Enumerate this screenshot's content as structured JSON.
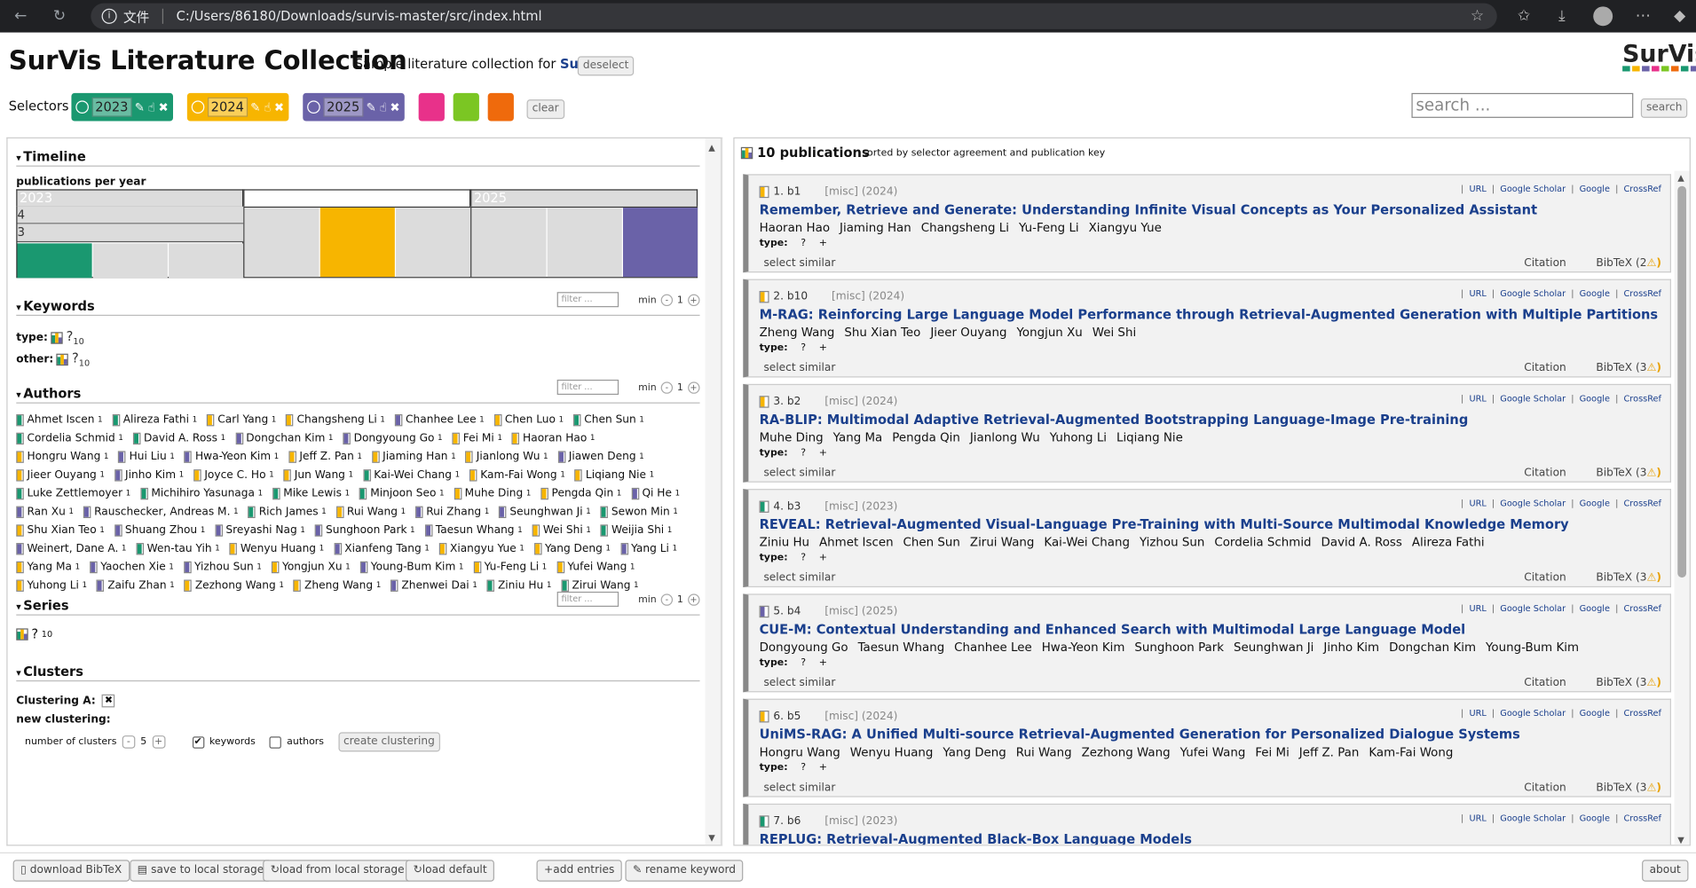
{
  "browser": {
    "protocol_label": "文件",
    "url": "C:/Users/86180/Downloads/survis-master/src/index.html"
  },
  "header": {
    "title": "SurVis Literature Collection",
    "subtitle_prefix": "Sample literature collection for ",
    "subtitle_link": "SurVis",
    "deselect": "deselect",
    "logo_text": "SurVis",
    "logo_colors": [
      "#1a9870",
      "#f7b500",
      "#6a62a8",
      "#e8318a",
      "#7bc623",
      "#ef6a0c",
      "#1a9870",
      "#6a62a8"
    ]
  },
  "selectors": {
    "label": "Selectors",
    "items": [
      {
        "year": "2023",
        "color": "#1a9870"
      },
      {
        "year": "2024",
        "color": "#f7b500"
      },
      {
        "year": "2025",
        "color": "#6a62a8"
      }
    ],
    "swatches": [
      "#e8318a",
      "#7bc623",
      "#ef6a0c"
    ],
    "clear": "clear"
  },
  "search": {
    "placeholder": "search ...",
    "button": "search"
  },
  "timeline": {
    "heading": "Timeline",
    "subheading": "publications per year",
    "years": [
      "2023",
      "2024",
      "2025"
    ],
    "axis_labels": [
      "4",
      "3"
    ]
  },
  "chart_data": {
    "type": "bar",
    "title": "publications per year",
    "categories": [
      "2023",
      "2024",
      "2025"
    ],
    "series": [
      {
        "values": [
          4,
          4,
          2
        ]
      }
    ]
  },
  "keywords": {
    "heading": "Keywords",
    "filter_placeholder": "filter ...",
    "min_label": "min",
    "min_value": "1",
    "rows": [
      {
        "label": "type:",
        "value": "?",
        "count": "10"
      },
      {
        "label": "other:",
        "value": "?",
        "count": "10"
      }
    ]
  },
  "authors": {
    "heading": "Authors",
    "filter_placeholder": "filter ...",
    "min_label": "min",
    "min_value": "1",
    "list": [
      {
        "name": "Ahmet Iscen",
        "n": "1",
        "c": "#1a9870"
      },
      {
        "name": "Alireza Fathi",
        "n": "1",
        "c": "#1a9870"
      },
      {
        "name": "Carl Yang",
        "n": "1",
        "c": "#f7b500"
      },
      {
        "name": "Changsheng Li",
        "n": "1",
        "c": "#f7b500"
      },
      {
        "name": "Chanhee Lee",
        "n": "1",
        "c": "#6a62a8"
      },
      {
        "name": "Chen Luo",
        "n": "1",
        "c": "#f7b500"
      },
      {
        "name": "Chen Sun",
        "n": "1",
        "c": "#1a9870"
      },
      {
        "name": "Cordelia Schmid",
        "n": "1",
        "c": "#1a9870"
      },
      {
        "name": "David A. Ross",
        "n": "1",
        "c": "#1a9870"
      },
      {
        "name": "Dongchan Kim",
        "n": "1",
        "c": "#6a62a8"
      },
      {
        "name": "Dongyoung Go",
        "n": "1",
        "c": "#6a62a8"
      },
      {
        "name": "Fei Mi",
        "n": "1",
        "c": "#f7b500"
      },
      {
        "name": "Haoran Hao",
        "n": "1",
        "c": "#f7b500"
      },
      {
        "name": "Hongru Wang",
        "n": "1",
        "c": "#f7b500"
      },
      {
        "name": "Hui Liu",
        "n": "1",
        "c": "#6a62a8"
      },
      {
        "name": "Hwa-Yeon Kim",
        "n": "1",
        "c": "#6a62a8"
      },
      {
        "name": "Jeff Z. Pan",
        "n": "1",
        "c": "#f7b500"
      },
      {
        "name": "Jiaming Han",
        "n": "1",
        "c": "#f7b500"
      },
      {
        "name": "Jianlong Wu",
        "n": "1",
        "c": "#f7b500"
      },
      {
        "name": "Jiawen Deng",
        "n": "1",
        "c": "#6a62a8"
      },
      {
        "name": "Jieer Ouyang",
        "n": "1",
        "c": "#f7b500"
      },
      {
        "name": "Jinho Kim",
        "n": "1",
        "c": "#6a62a8"
      },
      {
        "name": "Joyce C. Ho",
        "n": "1",
        "c": "#f7b500"
      },
      {
        "name": "Jun Wang",
        "n": "1",
        "c": "#f7b500"
      },
      {
        "name": "Kai-Wei Chang",
        "n": "1",
        "c": "#1a9870"
      },
      {
        "name": "Kam-Fai Wong",
        "n": "1",
        "c": "#f7b500"
      },
      {
        "name": "Liqiang Nie",
        "n": "1",
        "c": "#f7b500"
      },
      {
        "name": "Luke Zettlemoyer",
        "n": "1",
        "c": "#1a9870"
      },
      {
        "name": "Michihiro Yasunaga",
        "n": "1",
        "c": "#1a9870"
      },
      {
        "name": "Mike Lewis",
        "n": "1",
        "c": "#1a9870"
      },
      {
        "name": "Minjoon Seo",
        "n": "1",
        "c": "#1a9870"
      },
      {
        "name": "Muhe Ding",
        "n": "1",
        "c": "#f7b500"
      },
      {
        "name": "Pengda Qin",
        "n": "1",
        "c": "#f7b500"
      },
      {
        "name": "Qi He",
        "n": "1",
        "c": "#6a62a8"
      },
      {
        "name": "Ran Xu",
        "n": "1",
        "c": "#6a62a8"
      },
      {
        "name": "Rauschecker, Andreas M.",
        "n": "1",
        "c": "#6a62a8"
      },
      {
        "name": "Rich James",
        "n": "1",
        "c": "#1a9870"
      },
      {
        "name": "Rui Wang",
        "n": "1",
        "c": "#f7b500"
      },
      {
        "name": "Rui Zhang",
        "n": "1",
        "c": "#6a62a8"
      },
      {
        "name": "Seunghwan Ji",
        "n": "1",
        "c": "#6a62a8"
      },
      {
        "name": "Sewon Min",
        "n": "1",
        "c": "#1a9870"
      },
      {
        "name": "Shu Xian Teo",
        "n": "1",
        "c": "#f7b500"
      },
      {
        "name": "Shuang Zhou",
        "n": "1",
        "c": "#6a62a8"
      },
      {
        "name": "Sreyashi Nag",
        "n": "1",
        "c": "#6a62a8"
      },
      {
        "name": "Sunghoon Park",
        "n": "1",
        "c": "#6a62a8"
      },
      {
        "name": "Taesun Whang",
        "n": "1",
        "c": "#6a62a8"
      },
      {
        "name": "Wei Shi",
        "n": "1",
        "c": "#f7b500"
      },
      {
        "name": "Weijia Shi",
        "n": "1",
        "c": "#1a9870"
      },
      {
        "name": "Weinert, Dane A.",
        "n": "1",
        "c": "#6a62a8"
      },
      {
        "name": "Wen-tau Yih",
        "n": "1",
        "c": "#1a9870"
      },
      {
        "name": "Wenyu Huang",
        "n": "1",
        "c": "#f7b500"
      },
      {
        "name": "Xianfeng Tang",
        "n": "1",
        "c": "#6a62a8"
      },
      {
        "name": "Xiangyu Yue",
        "n": "1",
        "c": "#f7b500"
      },
      {
        "name": "Yang Deng",
        "n": "1",
        "c": "#f7b500"
      },
      {
        "name": "Yang Li",
        "n": "1",
        "c": "#6a62a8"
      },
      {
        "name": "Yang Ma",
        "n": "1",
        "c": "#f7b500"
      },
      {
        "name": "Yaochen Xie",
        "n": "1",
        "c": "#6a62a8"
      },
      {
        "name": "Yizhou Sun",
        "n": "1",
        "c": "#6a62a8"
      },
      {
        "name": "Yongjun Xu",
        "n": "1",
        "c": "#f7b500"
      },
      {
        "name": "Young-Bum Kim",
        "n": "1",
        "c": "#6a62a8"
      },
      {
        "name": "Yu-Feng Li",
        "n": "1",
        "c": "#f7b500"
      },
      {
        "name": "Yufei Wang",
        "n": "1",
        "c": "#f7b500"
      },
      {
        "name": "Yuhong Li",
        "n": "1",
        "c": "#f7b500"
      },
      {
        "name": "Zaifu Zhan",
        "n": "1",
        "c": "#6a62a8"
      },
      {
        "name": "Zezhong Wang",
        "n": "1",
        "c": "#f7b500"
      },
      {
        "name": "Zheng Wang",
        "n": "1",
        "c": "#f7b500"
      },
      {
        "name": "Zhenwei Dai",
        "n": "1",
        "c": "#6a62a8"
      },
      {
        "name": "Ziniu Hu",
        "n": "1",
        "c": "#1a9870"
      },
      {
        "name": "Zirui Wang",
        "n": "1",
        "c": "#1a9870"
      }
    ]
  },
  "series": {
    "heading": "Series",
    "filter_placeholder": "filter ...",
    "min_label": "min",
    "min_value": "1",
    "value": "?",
    "count": "10"
  },
  "clusters": {
    "heading": "Clusters",
    "clustering_a": "Clustering A:",
    "new_clustering": "new clustering:",
    "num_label": "number of clusters",
    "num_value": "5",
    "keywords_label": "keywords",
    "keywords_checked": true,
    "authors_label": "authors",
    "create": "create clustering"
  },
  "publications": {
    "count_label": "10 publications",
    "sort_info": "sorted by selector agreement and publication key",
    "links": [
      "URL",
      "Google Scholar",
      "Google",
      "CrossRef"
    ],
    "type_label": "type:",
    "select_similar": "select similar",
    "citation": "Citation",
    "items": [
      {
        "num": "1. b1",
        "meta": "[misc] (2024)",
        "color": "#f7b500",
        "title": "Remember, Retrieve and Generate: Understanding Infinite Visual Concepts as Your Personalized Assistant",
        "authors": [
          "Haoran Hao",
          "Jiaming Han",
          "Changsheng Li",
          "Yu-Feng Li",
          "Xiangyu Yue"
        ],
        "bibtex": "BibTeX (2",
        "warn": "⚠)"
      },
      {
        "num": "2. b10",
        "meta": "[misc] (2024)",
        "color": "#f7b500",
        "title": "M-RAG: Reinforcing Large Language Model Performance through Retrieval-Augmented Generation with Multiple Partitions",
        "authors": [
          "Zheng Wang",
          "Shu Xian Teo",
          "Jieer Ouyang",
          "Yongjun Xu",
          "Wei Shi"
        ],
        "bibtex": "BibTeX (3",
        "warn": "⚠)"
      },
      {
        "num": "3. b2",
        "meta": "[misc] (2024)",
        "color": "#f7b500",
        "title": "RA-BLIP: Multimodal Adaptive Retrieval-Augmented Bootstrapping Language-Image Pre-training",
        "authors": [
          "Muhe Ding",
          "Yang Ma",
          "Pengda Qin",
          "Jianlong Wu",
          "Yuhong Li",
          "Liqiang Nie"
        ],
        "bibtex": "BibTeX (3",
        "warn": "⚠)"
      },
      {
        "num": "4. b3",
        "meta": "[misc] (2023)",
        "color": "#1a9870",
        "title": "REVEAL: Retrieval-Augmented Visual-Language Pre-Training with Multi-Source Multimodal Knowledge Memory",
        "authors": [
          "Ziniu Hu",
          "Ahmet Iscen",
          "Chen Sun",
          "Zirui Wang",
          "Kai-Wei Chang",
          "Yizhou Sun",
          "Cordelia Schmid",
          "David A. Ross",
          "Alireza Fathi"
        ],
        "bibtex": "BibTeX (3",
        "warn": "⚠)"
      },
      {
        "num": "5. b4",
        "meta": "[misc] (2025)",
        "color": "#6a62a8",
        "title": "CUE-M: Contextual Understanding and Enhanced Search with Multimodal Large Language Model",
        "authors": [
          "Dongyoung Go",
          "Taesun Whang",
          "Chanhee Lee",
          "Hwa-Yeon Kim",
          "Sunghoon Park",
          "Seunghwan Ji",
          "Jinho Kim",
          "Dongchan Kim",
          "Young-Bum Kim"
        ],
        "bibtex": "BibTeX (3",
        "warn": "⚠)"
      },
      {
        "num": "6. b5",
        "meta": "[misc] (2024)",
        "color": "#f7b500",
        "title": "UniMS-RAG: A Unified Multi-source Retrieval-Augmented Generation for Personalized Dialogue Systems",
        "authors": [
          "Hongru Wang",
          "Wenyu Huang",
          "Yang Deng",
          "Rui Wang",
          "Zezhong Wang",
          "Yufei Wang",
          "Fei Mi",
          "Jeff Z. Pan",
          "Kam-Fai Wong"
        ],
        "bibtex": "BibTeX (3",
        "warn": "⚠)"
      },
      {
        "num": "7. b6",
        "meta": "[misc] (2023)",
        "color": "#1a9870",
        "title": "REPLUG: Retrieval-Augmented Black-Box Language Models",
        "authors": [],
        "bibtex": "",
        "warn": ""
      }
    ]
  },
  "footer": {
    "download": "download BibTeX",
    "save": "save to local storage",
    "load": "load from local storage",
    "load_default": "load default",
    "add": "add entries",
    "rename": "rename keyword",
    "about": "about"
  }
}
